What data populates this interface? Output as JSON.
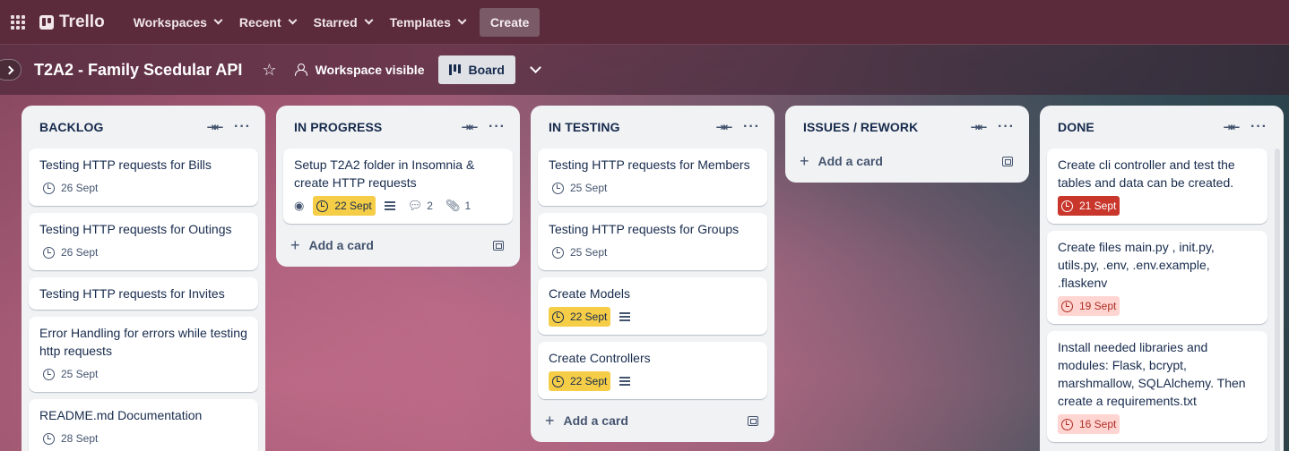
{
  "topnav": {
    "logo": "Trello",
    "items": [
      "Workspaces",
      "Recent",
      "Starred",
      "Templates"
    ],
    "create_label": "Create"
  },
  "board": {
    "title": "T2A2 - Family Scedular API",
    "visibility": "Workspace visible",
    "view_label": "Board"
  },
  "add_card_label": "Add a card",
  "lists": [
    {
      "title": "BACKLOG",
      "cards": [
        {
          "title": "Testing HTTP requests for Bills",
          "due": "26 Sept"
        },
        {
          "title": "Testing HTTP requests for Outings",
          "due": "26 Sept"
        },
        {
          "title": "Testing HTTP requests for Invites"
        },
        {
          "title": "Error Handling for errors while testing http requests",
          "due": "25 Sept"
        },
        {
          "title": "README.md Documentation",
          "due": "28 Sept"
        }
      ]
    },
    {
      "title": "IN PROGRESS",
      "cards": [
        {
          "title": "Setup T2A2 folder in Insomnia & create HTTP requests",
          "due": "22 Sept",
          "comments": "2",
          "attachments": "1"
        }
      ]
    },
    {
      "title": "IN TESTING",
      "cards": [
        {
          "title": "Testing HTTP requests for Members",
          "due": "25 Sept"
        },
        {
          "title": "Testing HTTP requests for Groups",
          "due": "25 Sept"
        },
        {
          "title": "Create Models",
          "due": "22 Sept"
        },
        {
          "title": "Create Controllers",
          "due": "22 Sept"
        }
      ]
    },
    {
      "title": "ISSUES / REWORK",
      "cards": []
    },
    {
      "title": "DONE",
      "cards": [
        {
          "title": "Create cli controller and test the tables and data can be created.",
          "due": "21 Sept"
        },
        {
          "title": "Create files main.py , init.py, utils.py, .env, .env.example, .flaskenv",
          "due": "19 Sept"
        },
        {
          "title": "Install needed libraries and modules: Flask, bcrypt, marshmallow, SQLAlchemy. Then create a requirements.txt",
          "due": "16 Sept"
        }
      ]
    }
  ]
}
